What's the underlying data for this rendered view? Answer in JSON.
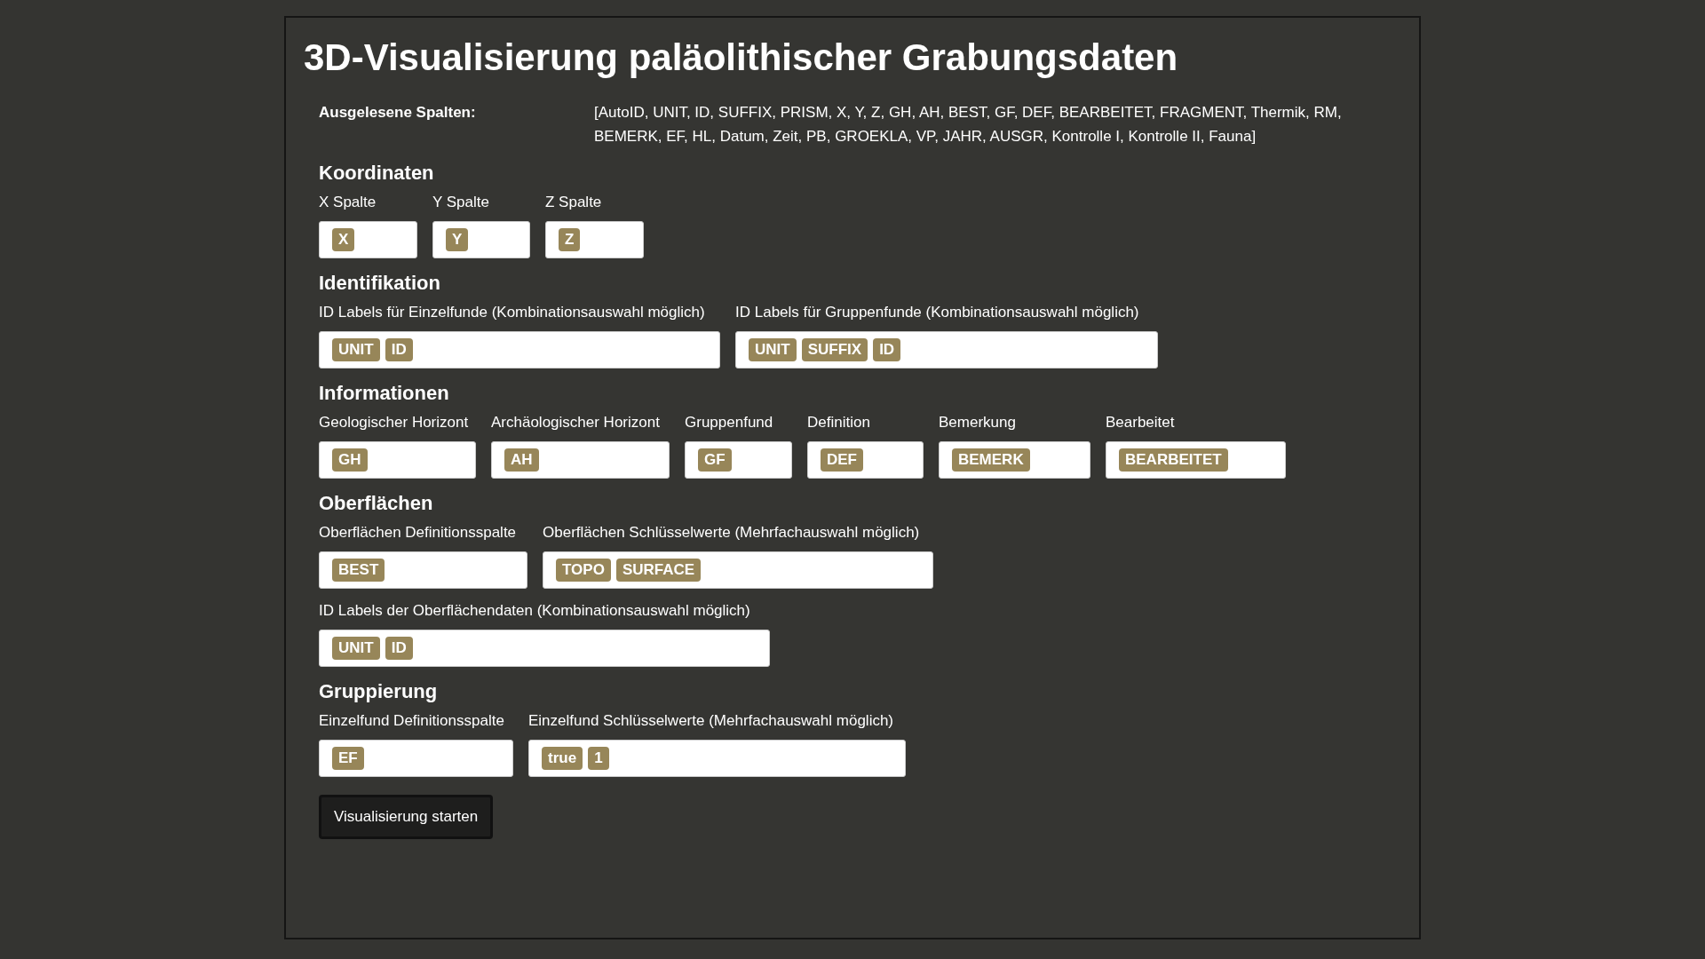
{
  "title": "3D-Visualisierung paläolithischer Grabungsdaten",
  "columns_read": {
    "label": "Ausgelesene Spalten:",
    "value": "[AutoID, UNIT, ID, SUFFIX, PRISM, X, Y, Z, GH, AH, BEST, GF, DEF, BEARBEITET, FRAGMENT, Thermik, RM, BEMERK, EF, HL, Datum, Zeit, PB, GROEKLA, VP, JAHR, AUSGR, Kontrolle I, Kontrolle II, Fauna]"
  },
  "sections": [
    {
      "heading": "Koordinaten",
      "rows": [
        [
          {
            "label": "X Spalte",
            "tags": [
              "X"
            ]
          },
          {
            "label": "Y Spalte",
            "tags": [
              "Y"
            ]
          },
          {
            "label": "Z Spalte",
            "tags": [
              "Z"
            ]
          }
        ]
      ]
    },
    {
      "heading": "Identifikation",
      "rows": [
        [
          {
            "label": "ID Labels für Einzelfunde (Kombinationsauswahl möglich)",
            "tags": [
              "UNIT",
              "ID"
            ]
          },
          {
            "label": "ID Labels für Gruppenfunde (Kombinationsauswahl möglich)",
            "tags": [
              "UNIT",
              "SUFFIX",
              "ID"
            ]
          }
        ]
      ]
    },
    {
      "heading": "Informationen",
      "rows": [
        [
          {
            "label": "Geologischer Horizont",
            "tags": [
              "GH"
            ]
          },
          {
            "label": "Archäologischer Horizont",
            "tags": [
              "AH"
            ]
          },
          {
            "label": "Gruppenfund",
            "tags": [
              "GF"
            ]
          },
          {
            "label": "Definition",
            "tags": [
              "DEF"
            ]
          },
          {
            "label": "Bemerkung",
            "tags": [
              "BEMERK"
            ]
          },
          {
            "label": "Bearbeitet",
            "tags": [
              "BEARBEITET"
            ]
          }
        ]
      ]
    },
    {
      "heading": "Oberflächen",
      "rows": [
        [
          {
            "label": "Oberflächen Definitionsspalte",
            "tags": [
              "BEST"
            ]
          },
          {
            "label": "Oberflächen Schlüsselwerte (Mehrfachauswahl möglich)",
            "tags": [
              "TOPO",
              "SURFACE"
            ]
          }
        ],
        [
          {
            "label": "ID Labels der Oberflächendaten (Kombinationsauswahl möglich)",
            "tags": [
              "UNIT",
              "ID"
            ]
          }
        ]
      ]
    },
    {
      "heading": "Gruppierung",
      "rows": [
        [
          {
            "label": "Einzelfund Definitionsspalte",
            "tags": [
              "EF"
            ]
          },
          {
            "label": "Einzelfund Schlüsselwerte (Mehrfachauswahl möglich)",
            "tags": [
              "true",
              "1"
            ]
          }
        ]
      ]
    }
  ],
  "button": "Visualisierung starten"
}
